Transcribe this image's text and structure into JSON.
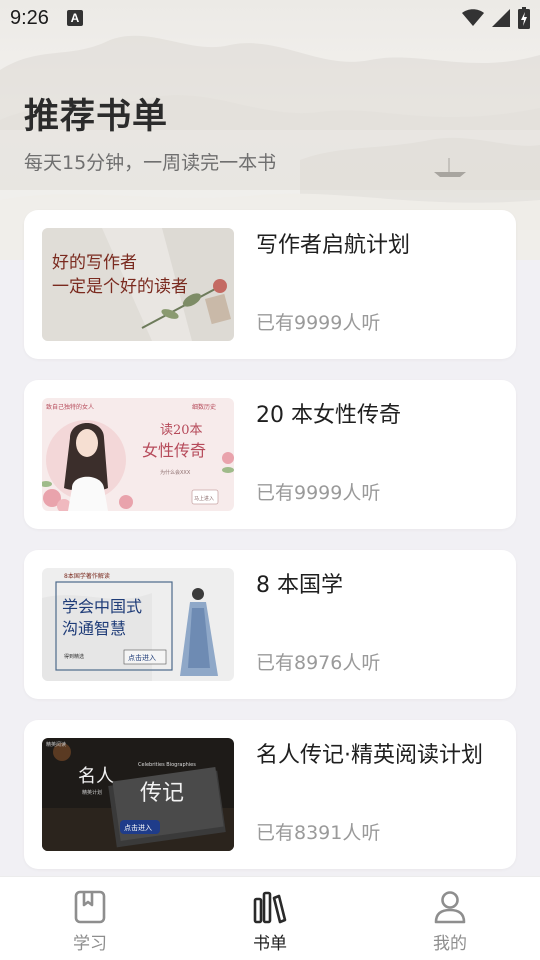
{
  "status_bar": {
    "time": "9:26",
    "notification_icon": "A"
  },
  "header": {
    "title": "推荐书单",
    "subtitle": "每天15分钟，一周读完一本书"
  },
  "books": [
    {
      "title": "写作者启航计划",
      "listeners": "已有9999人听",
      "cover_text": [
        "好的写作者",
        "一定是个好的读者"
      ]
    },
    {
      "title": "20 本女性传奇",
      "listeners": "已有9999人听",
      "cover_text": [
        "读20本",
        "女性传奇",
        "致自己独特的女人",
        "细数历史",
        "为什么会XXX",
        "马上进入"
      ]
    },
    {
      "title": "8 本国学",
      "listeners": "已有8976人听",
      "cover_text": [
        "学会中国式",
        "沟通智慧",
        "8本国学著作解读",
        "得到精选",
        "点击进入"
      ]
    },
    {
      "title": "名人传记·精英阅读计划",
      "listeners": "已有8391人听",
      "cover_text": [
        "名人",
        "传记",
        "精英阅读",
        "Celebrities Biographies",
        "精英计划",
        "点击进入"
      ]
    }
  ],
  "bottom_nav": [
    {
      "label": "学习",
      "icon": "bookmark-book-icon",
      "active": false
    },
    {
      "label": "书单",
      "icon": "bookshelf-icon",
      "active": true
    },
    {
      "label": "我的",
      "icon": "person-icon",
      "active": false
    }
  ]
}
